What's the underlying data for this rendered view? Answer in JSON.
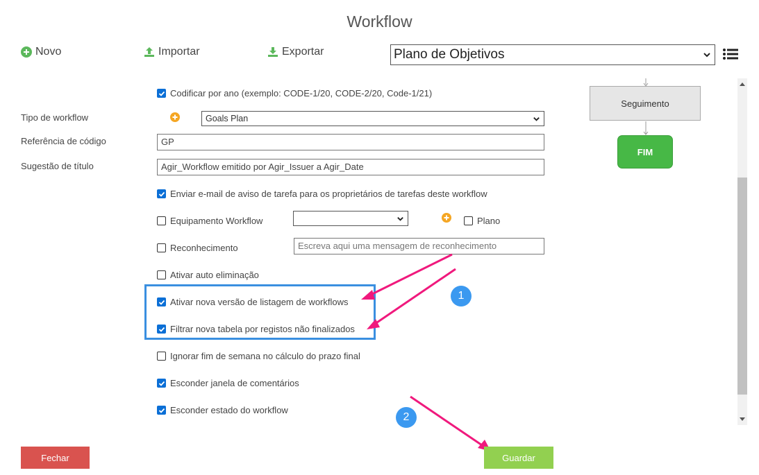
{
  "page": {
    "title": "Workflow"
  },
  "toolbar": {
    "new_label": "Novo",
    "import_label": "Importar",
    "export_label": "Exportar",
    "plan_select_value": "Plano de Objetivos"
  },
  "form": {
    "codify_label": "Codificar por ano (exemplo: CODE-1/20, CODE-2/20, Code-1/21)",
    "workflow_type_label": "Tipo de workflow",
    "workflow_type_value": "Goals Plan",
    "code_ref_label": "Referência de código",
    "code_ref_value": "GP",
    "title_suggestion_label": "Sugestão de título",
    "title_suggestion_value": "Agir_Workflow emitido por Agir_Issuer a Agir_Date",
    "send_email_label": "Enviar e-mail de aviso de tarefa para os proprietários de tarefas deste workflow",
    "team_label": "Equipamento Workflow",
    "team_select_value": "",
    "plan_label": "Plano",
    "recognition_label": "Reconhecimento",
    "recognition_placeholder": "Escreva aqui uma mensagem de reconhecimento",
    "auto_delete_label": "Ativar auto eliminação",
    "new_listing_label": "Ativar nova versão de listagem de workflows",
    "filter_table_label": "Filtrar nova tabela por registos não finalizados",
    "ignore_weekend_label": "Ignorar fim de semana no cálculo do prazo final",
    "hide_comments_label": "Esconder janela de comentários",
    "hide_state_label": "Esconder estado do workflow"
  },
  "checkboxes": {
    "codify": true,
    "send_email": true,
    "team": false,
    "plan": false,
    "recognition": false,
    "auto_delete": false,
    "new_listing": true,
    "filter_table": true,
    "ignore_weekend": false,
    "hide_comments": true,
    "hide_state": true
  },
  "diagram": {
    "seg_label": "Seguimento",
    "fim_label": "FIM"
  },
  "annotations": {
    "badge_1": "1",
    "badge_2": "2"
  },
  "footer": {
    "close_label": "Fechar",
    "save_label": "Guardar"
  },
  "colors": {
    "checkbox_blue": "#0b6fd6",
    "highlight_blue": "#3a8fe0",
    "arrow_pink": "#f0197d",
    "close_red": "#d9534f",
    "save_green": "#92d050",
    "fim_green": "#47b846"
  },
  "icons": {
    "new": "plus-circle-icon",
    "import": "upload-icon",
    "export": "download-icon",
    "menu": "list-icon"
  }
}
